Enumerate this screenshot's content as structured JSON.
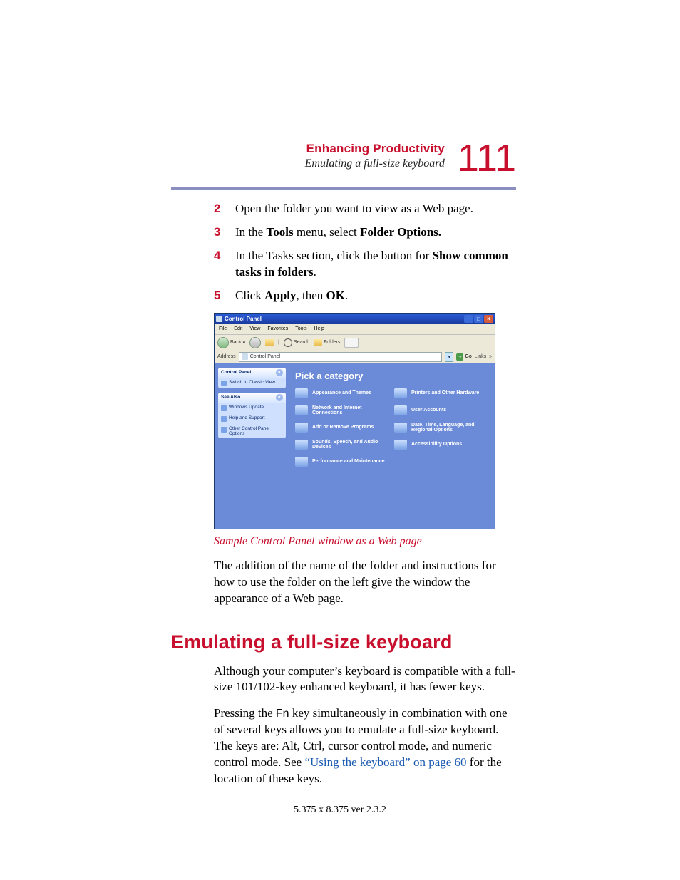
{
  "header": {
    "chapter": "Enhancing Productivity",
    "section": "Emulating a full-size keyboard",
    "page_number": "111"
  },
  "steps": [
    {
      "num": "2",
      "text_before": "Open the folder you want to view as a Web page.",
      "bold1": "",
      "mid": "",
      "bold2": "",
      "after": ""
    },
    {
      "num": "3",
      "text_before": "In the ",
      "bold1": "Tools",
      "mid": " menu, select ",
      "bold2": "Folder Options.",
      "after": ""
    },
    {
      "num": "4",
      "text_before": "In the Tasks section, click the button for ",
      "bold1": "Show common tasks in folders",
      "mid": "",
      "bold2": "",
      "after": "."
    },
    {
      "num": "5",
      "text_before": " Click ",
      "bold1": "Apply",
      "mid": ", then ",
      "bold2": "OK",
      "after": "."
    }
  ],
  "figure": {
    "title": "Control Panel",
    "menubar": [
      "File",
      "Edit",
      "View",
      "Favorites",
      "Tools",
      "Help"
    ],
    "toolbar": {
      "back": "Back",
      "search": "Search",
      "folders": "Folders"
    },
    "addressbar": {
      "label": "Address",
      "value": "Control Panel",
      "go": "Go",
      "links": "Links"
    },
    "sidebar": {
      "box1_head": "Control Panel",
      "box1_item": "Switch to Classic View",
      "box2_head": "See Also",
      "box2_items": [
        "Windows Update",
        "Help and Support",
        "Other Control Panel Options"
      ]
    },
    "main_heading": "Pick a category",
    "categories": [
      "Appearance and Themes",
      "Printers and Other Hardware",
      "Network and Internet Connections",
      "User Accounts",
      "Add or Remove Programs",
      "Date, Time, Language, and Regional Options",
      "Sounds, Speech, and Audio Devices",
      "Accessibility Options",
      "Performance and Maintenance"
    ],
    "caption": "Sample Control Panel window as a Web page"
  },
  "para1": "The addition of the name of the folder and instructions for how to use the folder on the left give the window the appearance of a Web page.",
  "h1": "Emulating a full-size keyboard",
  "para2": "Although your computer’s keyboard is compatible with a full-size 101/102-key enhanced keyboard, it has fewer keys.",
  "para3_a": "Pressing the ",
  "para3_fn": "Fn",
  "para3_b": " key simultaneously in combination with one of several keys allows you to emulate a full-size keyboard. The keys are: Alt, Ctrl, cursor control mode, and numeric control mode. See ",
  "para3_link": "“Using the keyboard” on page 60",
  "para3_c": " for the location of these keys.",
  "footer": "5.375 x 8.375 ver 2.3.2"
}
